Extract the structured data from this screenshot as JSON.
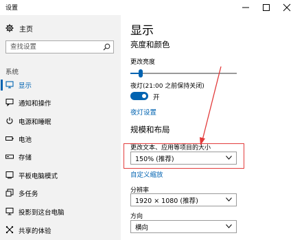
{
  "window": {
    "title": "设置"
  },
  "sidebar": {
    "home_label": "主页",
    "search_placeholder": "查找设置",
    "section_label": "系统",
    "items": [
      {
        "label": "显示",
        "icon": "monitor-icon",
        "active": true
      },
      {
        "label": "通知和操作",
        "icon": "message-icon"
      },
      {
        "label": "电源和睡眠",
        "icon": "power-icon"
      },
      {
        "label": "电池",
        "icon": "battery-icon"
      },
      {
        "label": "存储",
        "icon": "storage-icon"
      },
      {
        "label": "平板电脑模式",
        "icon": "tablet-icon"
      },
      {
        "label": "多任务",
        "icon": "multitask-icon"
      },
      {
        "label": "投影到这台电脑",
        "icon": "project-icon"
      },
      {
        "label": "共享的体验",
        "icon": "share-icon"
      }
    ]
  },
  "main": {
    "title": "显示",
    "brightness_heading": "亮度和颜色",
    "brightness_label": "更改亮度",
    "brightness_value": 0.08,
    "night_light_label": "夜灯(21:00 之前保持关闭)",
    "night_light_toggle_label": "开",
    "night_light_settings_link": "夜灯设置",
    "scale_heading": "规模和布局",
    "scale_label": "更改文本、应用等项目的大小",
    "scale_value": "150% (推荐)",
    "custom_scaling_link": "自定义缩放",
    "resolution_label": "分辨率",
    "resolution_value": "1920 × 1080 (推荐)",
    "orientation_label": "方向",
    "orientation_value": "横向"
  },
  "colors": {
    "accent": "#0063b1",
    "sidebar_bg": "#f2f2f2",
    "annotation": "#e23a3a"
  }
}
